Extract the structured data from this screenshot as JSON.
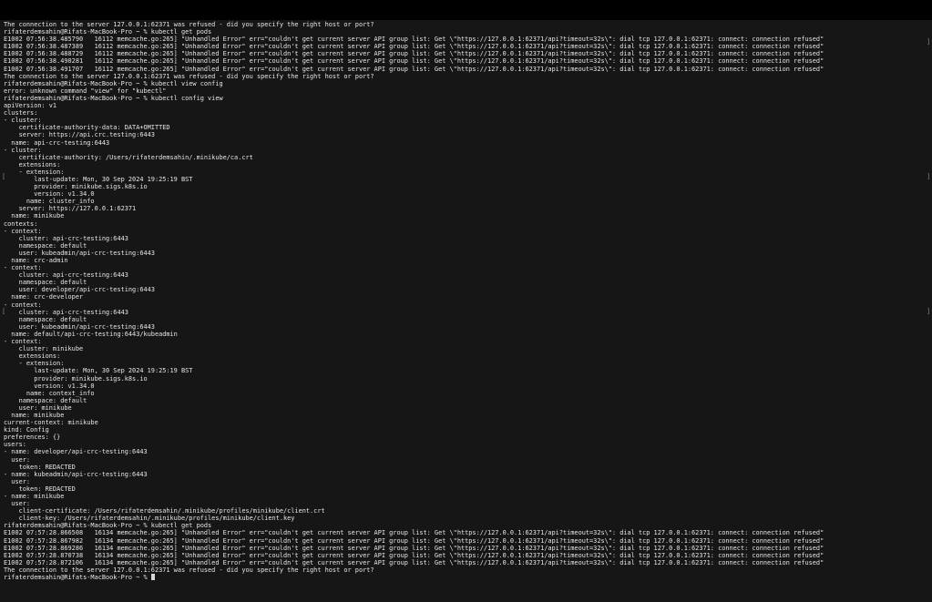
{
  "terminal": {
    "lines": [
      "The connection to the server 127.0.0.1:62371 was refused - did you specify the right host or port?",
      "rifaterdemsahin@Rifats-MacBook-Pro ~ % kubectl get pods",
      "E1002 07:56:38.485790   16112 memcache.go:265] \"Unhandled Error\" err=\"couldn't get current server API group list: Get \\\"https://127.0.0.1:62371/api?timeout=32s\\\": dial tcp 127.0.0.1:62371: connect: connection refused\"",
      "E1002 07:56:38.487389   16112 memcache.go:265] \"Unhandled Error\" err=\"couldn't get current server API group list: Get \\\"https://127.0.0.1:62371/api?timeout=32s\\\": dial tcp 127.0.0.1:62371: connect: connection refused\"",
      "E1002 07:56:38.488729   16112 memcache.go:265] \"Unhandled Error\" err=\"couldn't get current server API group list: Get \\\"https://127.0.0.1:62371/api?timeout=32s\\\": dial tcp 127.0.0.1:62371: connect: connection refused\"",
      "E1002 07:56:38.490281   16112 memcache.go:265] \"Unhandled Error\" err=\"couldn't get current server API group list: Get \\\"https://127.0.0.1:62371/api?timeout=32s\\\": dial tcp 127.0.0.1:62371: connect: connection refused\"",
      "E1002 07:56:38.491707   16112 memcache.go:265] \"Unhandled Error\" err=\"couldn't get current server API group list: Get \\\"https://127.0.0.1:62371/api?timeout=32s\\\": dial tcp 127.0.0.1:62371: connect: connection refused\"",
      "The connection to the server 127.0.0.1:62371 was refused - did you specify the right host or port?",
      "rifaterdemsahin@Rifats-MacBook-Pro ~ % kubectl view config",
      "error: unknown command \"view\" for \"kubectl\"",
      "rifaterdemsahin@Rifats-MacBook-Pro ~ % kubectl config view",
      "apiVersion: v1",
      "clusters:",
      "- cluster:",
      "    certificate-authority-data: DATA+OMITTED",
      "    server: https://api.crc.testing:6443",
      "  name: api-crc-testing:6443",
      "- cluster:",
      "    certificate-authority: /Users/rifaterdemsahin/.minikube/ca.crt",
      "    extensions:",
      "    - extension:",
      "        last-update: Mon, 30 Sep 2024 19:25:19 BST",
      "        provider: minikube.sigs.k8s.io",
      "        version: v1.34.0",
      "      name: cluster_info",
      "    server: https://127.0.0.1:62371",
      "  name: minikube",
      "contexts:",
      "- context:",
      "    cluster: api-crc-testing:6443",
      "    namespace: default",
      "    user: kubeadmin/api-crc-testing:6443",
      "  name: crc-admin",
      "- context:",
      "    cluster: api-crc-testing:6443",
      "    namespace: default",
      "    user: developer/api-crc-testing:6443",
      "  name: crc-developer",
      "- context:",
      "    cluster: api-crc-testing:6443",
      "    namespace: default",
      "    user: kubeadmin/api-crc-testing:6443",
      "  name: default/api-crc-testing:6443/kubeadmin",
      "- context:",
      "    cluster: minikube",
      "    extensions:",
      "    - extension:",
      "        last-update: Mon, 30 Sep 2024 19:25:19 BST",
      "        provider: minikube.sigs.k8s.io",
      "        version: v1.34.0",
      "      name: context_info",
      "    namespace: default",
      "    user: minikube",
      "  name: minikube",
      "current-context: minikube",
      "kind: Config",
      "preferences: {}",
      "users:",
      "- name: developer/api-crc-testing:6443",
      "  user:",
      "    token: REDACTED",
      "- name: kubeadmin/api-crc-testing:6443",
      "  user:",
      "    token: REDACTED",
      "- name: minikube",
      "  user:",
      "    client-certificate: /Users/rifaterdemsahin/.minikube/profiles/minikube/client.crt",
      "    client-key: /Users/rifaterdemsahin/.minikube/profiles/minikube/client.key",
      "rifaterdemsahin@Rifats-MacBook-Pro ~ % kubectl get pods",
      "E1002 07:57:28.866508   16134 memcache.go:265] \"Unhandled Error\" err=\"couldn't get current server API group list: Get \\\"https://127.0.0.1:62371/api?timeout=32s\\\": dial tcp 127.0.0.1:62371: connect: connection refused\"",
      "E1002 07:57:28.867982   16134 memcache.go:265] \"Unhandled Error\" err=\"couldn't get current server API group list: Get \\\"https://127.0.0.1:62371/api?timeout=32s\\\": dial tcp 127.0.0.1:62371: connect: connection refused\"",
      "E1002 07:57:28.869286   16134 memcache.go:265] \"Unhandled Error\" err=\"couldn't get current server API group list: Get \\\"https://127.0.0.1:62371/api?timeout=32s\\\": dial tcp 127.0.0.1:62371: connect: connection refused\"",
      "E1002 07:57:28.870738   16134 memcache.go:265] \"Unhandled Error\" err=\"couldn't get current server API group list: Get \\\"https://127.0.0.1:62371/api?timeout=32s\\\": dial tcp 127.0.0.1:62371: connect: connection refused\"",
      "E1002 07:57:28.872106   16134 memcache.go:265] \"Unhandled Error\" err=\"couldn't get current server API group list: Get \\\"https://127.0.0.1:62371/api?timeout=32s\\\": dial tcp 127.0.0.1:62371: connect: connection refused\"",
      "The connection to the server 127.0.0.1:62371 was refused - did you specify the right host or port?"
    ],
    "prompt": "rifaterdemsahin@Rifats-MacBook-Pro ~ % "
  },
  "colors": {
    "background": "#161616",
    "text": "#e6e6e6",
    "cursor": "#d8d8d8"
  }
}
